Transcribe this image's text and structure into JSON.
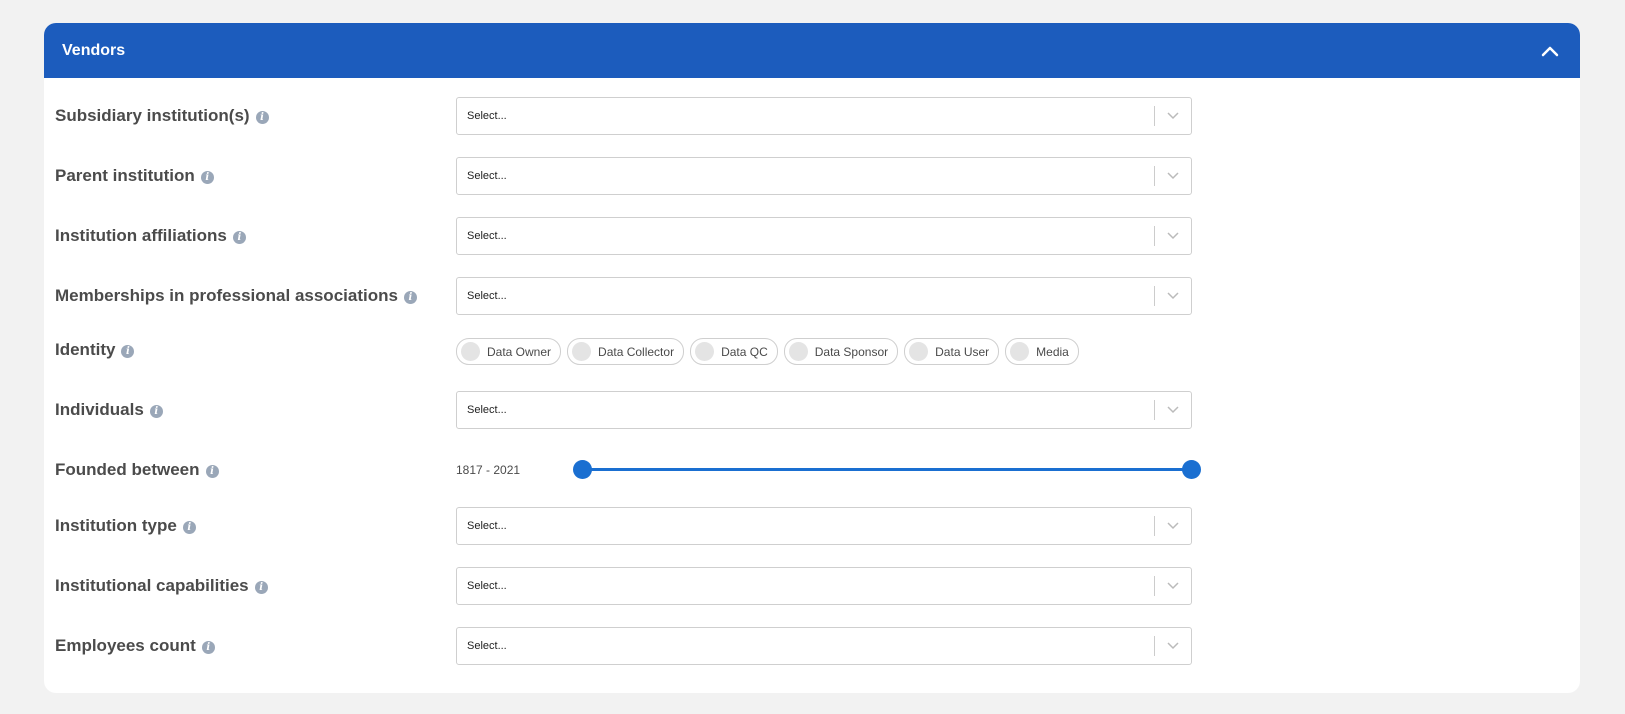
{
  "panel": {
    "title": "Vendors",
    "collapse_icon": "chevron-up-icon",
    "accent_color": "#1c5cbd"
  },
  "fields": {
    "subsidiary": {
      "label": "Subsidiary institution(s)",
      "value": "Select..."
    },
    "parent": {
      "label": "Parent institution",
      "value": "Select..."
    },
    "affiliations": {
      "label": "Institution affiliations",
      "value": "Select..."
    },
    "memberships": {
      "label": "Memberships in professional associations",
      "value": "Select..."
    },
    "identity": {
      "label": "Identity",
      "options": [
        "Data Owner",
        "Data Collector",
        "Data QC",
        "Data Sponsor",
        "Data User",
        "Media"
      ]
    },
    "individuals": {
      "label": "Individuals",
      "value": "Select..."
    },
    "founded": {
      "label": "Founded between",
      "range_text": "1817 - 2021",
      "min": 1817,
      "max": 2021
    },
    "institution_type": {
      "label": "Institution type",
      "value": "Select..."
    },
    "capabilities": {
      "label": "Institutional capabilities",
      "value": "Select..."
    },
    "employees": {
      "label": "Employees count",
      "value": "Select..."
    }
  }
}
